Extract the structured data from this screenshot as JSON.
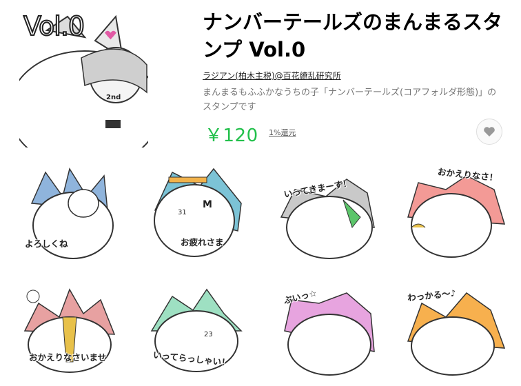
{
  "pack": {
    "cover_label": "Vol.0",
    "title": "ナンバーテールズのまんまるスタンプ Vol.0",
    "author": "ラジアン(柏木主税)@百花繚乱研究所",
    "description": "まんまるもふふかなうちの子「ナンバーテールズ(コアフォルダ形態)」のスタンプです",
    "price": "￥120",
    "refund_label": "1%還元",
    "cover_tag": "2nd",
    "icons": {
      "favorite": "heart-icon"
    }
  },
  "stickers": [
    {
      "caption": "よろしくね",
      "color": "#8fb4dc"
    },
    {
      "caption": "お疲れさま",
      "color": "#7cc3d6",
      "tags": [
        "31",
        "M"
      ]
    },
    {
      "caption": "いってきまーす！",
      "color": "#c9c9c9"
    },
    {
      "caption": "おかえりなさ！",
      "color": "#f39a96"
    },
    {
      "caption": "おかえりなさいませ",
      "color": "#e7a1a1"
    },
    {
      "caption": "いってらっしゃい！",
      "color": "#9ee0c2",
      "tags": [
        "23"
      ]
    },
    {
      "caption": "ぶいっ☆",
      "color": "#e7a4df"
    },
    {
      "caption": "わっかる～♪",
      "color": "#f7b04e"
    }
  ]
}
